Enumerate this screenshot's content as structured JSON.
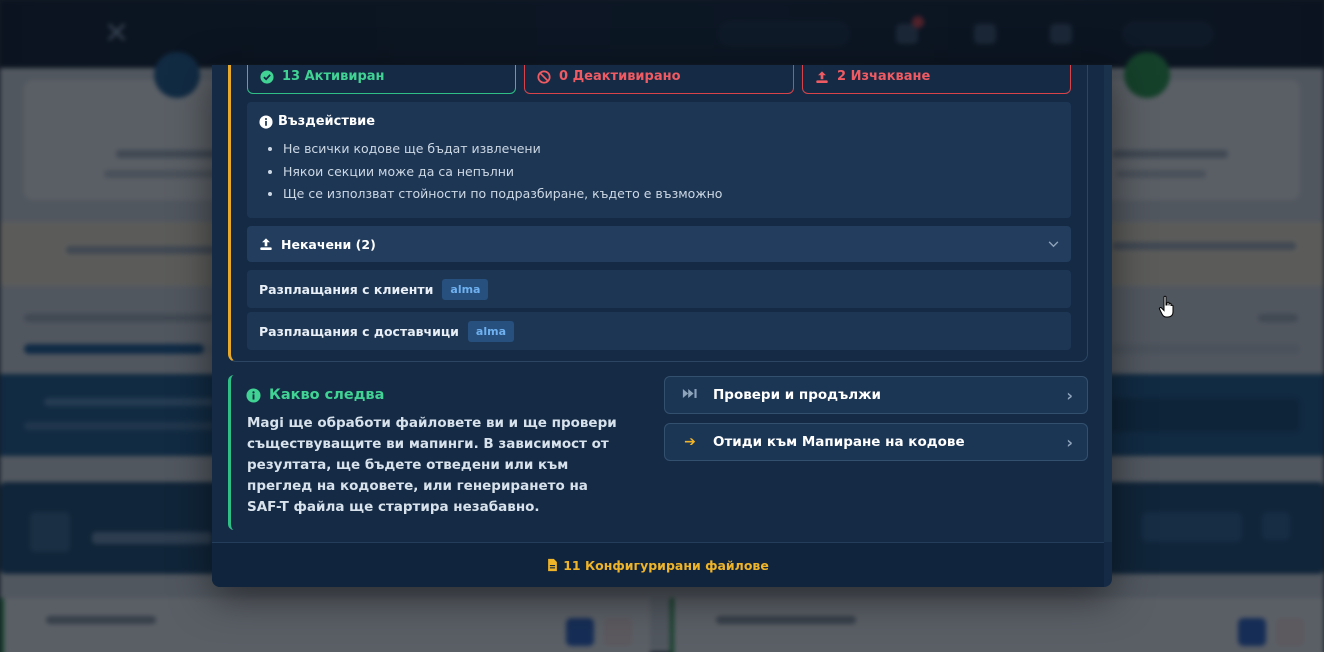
{
  "modal": {
    "stats": {
      "activated": "13 Активиран",
      "deactivated": "0 Деактивирано",
      "pending": "2 Изчакване"
    },
    "impact": {
      "title": "Въздействие",
      "items": [
        "Не всички кодове ще бъдат извлечени",
        "Някои секции може да са непълни",
        "Ще се използват стойности по подразбиране, където е възможно"
      ]
    },
    "not_uploaded": {
      "label": "Некачени (2)",
      "rows": [
        {
          "label": "Разплащания с клиенти",
          "tag": "alma"
        },
        {
          "label": "Разплащания с доставчици",
          "tag": "alma"
        }
      ]
    },
    "next": {
      "title": "Какво следва",
      "text": "Magi ще обработи файловете ви и ще провери съществуващите ви мапинги. В зависимост от резултата, ще бъдете отведени или към преглед на кодовете, или генерирането на SAF-T файла ще стартира незабавно."
    },
    "actions": {
      "check_continue": "Провери и продължи",
      "go_mapping": "Отиди към Мапиране на кодове"
    },
    "footer": "11 Конфигурирани файлове"
  },
  "colors": {
    "success": "#40d394",
    "danger": "#f05a62",
    "warning": "#f0b429",
    "tag": "#6fb1f0"
  }
}
